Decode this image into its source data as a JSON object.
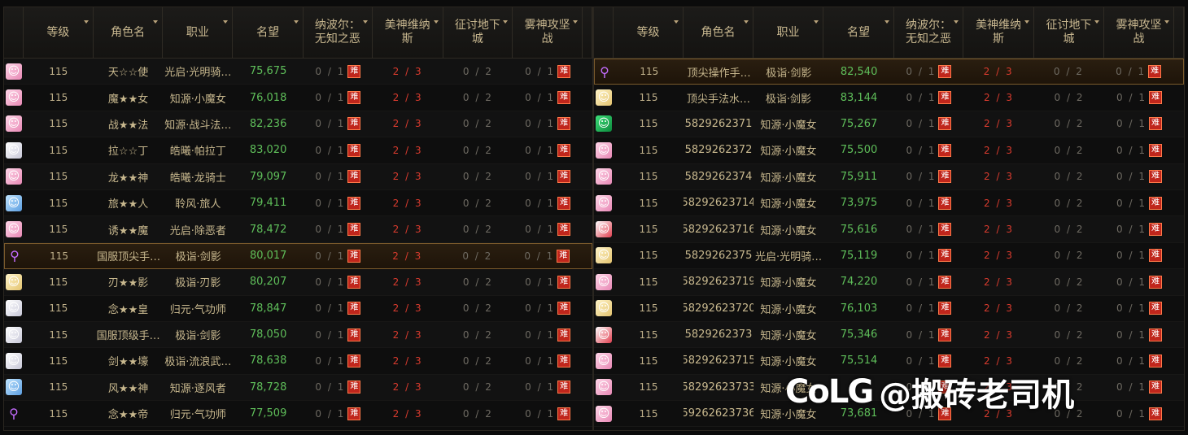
{
  "columns": {
    "level": "等级",
    "name": "角色名",
    "job": "职业",
    "reputation": "名望",
    "nabel": "纳波尔：\n无知之恶",
    "venus": "美神维纳\n斯",
    "dungeon": "征讨地下\n城",
    "fog": "雾神攻坚\n战"
  },
  "hard_badge": "难",
  "left_rows": [
    {
      "icon": "avatar-pink-icon",
      "tone": "pink",
      "level": "115",
      "name": "天☆☆使",
      "job": "光启·光明骑…",
      "rep": "75,675",
      "nabel": "0 / 1",
      "venus": "2 / 3",
      "dungeon": "0 / 2",
      "fog": "0 / 1"
    },
    {
      "icon": "avatar-pink-icon",
      "tone": "pink",
      "level": "115",
      "name": "魔★★女",
      "job": "知源·小魔女",
      "rep": "76,018",
      "nabel": "0 / 1",
      "venus": "2 / 3",
      "dungeon": "0 / 2",
      "fog": "0 / 1"
    },
    {
      "icon": "avatar-pink-icon",
      "tone": "pink",
      "level": "115",
      "name": "战★★法",
      "job": "知源·战斗法…",
      "rep": "82,236",
      "nabel": "0 / 1",
      "venus": "2 / 3",
      "dungeon": "0 / 2",
      "fog": "0 / 1"
    },
    {
      "icon": "avatar-white-icon",
      "tone": "white",
      "level": "115",
      "name": "拉☆☆丁",
      "job": "皓曦·帕拉丁",
      "rep": "83,020",
      "nabel": "0 / 1",
      "venus": "2 / 3",
      "dungeon": "0 / 2",
      "fog": "0 / 1"
    },
    {
      "icon": "avatar-pink-icon",
      "tone": "pink",
      "level": "115",
      "name": "龙★★神",
      "job": "皓曦·龙骑士",
      "rep": "79,097",
      "nabel": "0 / 1",
      "venus": "2 / 3",
      "dungeon": "0 / 2",
      "fog": "0 / 1"
    },
    {
      "icon": "avatar-blue-icon",
      "tone": "blue",
      "level": "115",
      "name": "旅★★人",
      "job": "聆风·旅人",
      "rep": "79,411",
      "nabel": "0 / 1",
      "venus": "2 / 3",
      "dungeon": "0 / 2",
      "fog": "0 / 1"
    },
    {
      "icon": "avatar-pink-icon",
      "tone": "pink",
      "level": "115",
      "name": "诱★★魔",
      "job": "光启·除恶者",
      "rep": "78,472",
      "nabel": "0 / 1",
      "venus": "2 / 3",
      "dungeon": "0 / 2",
      "fog": "0 / 1"
    },
    {
      "icon": "sword-icon",
      "tone": "purple",
      "level": "115",
      "name": "国服顶尖手…",
      "job": "极诣·剑影",
      "rep": "80,017",
      "nabel": "0 / 1",
      "venus": "2 / 3",
      "dungeon": "0 / 2",
      "fog": "0 / 1",
      "highlight": true
    },
    {
      "icon": "avatar-blond-icon",
      "tone": "blond",
      "level": "115",
      "name": "刃★★影",
      "job": "极诣·刃影",
      "rep": "80,207",
      "nabel": "0 / 1",
      "venus": "2 / 3",
      "dungeon": "0 / 2",
      "fog": "0 / 1"
    },
    {
      "icon": "avatar-white-icon",
      "tone": "white",
      "level": "115",
      "name": "念★★皇",
      "job": "归元·气功师",
      "rep": "78,847",
      "nabel": "0 / 1",
      "venus": "2 / 3",
      "dungeon": "0 / 2",
      "fog": "0 / 1"
    },
    {
      "icon": "avatar-white-icon",
      "tone": "white",
      "level": "115",
      "name": "国服顶级手…",
      "job": "极诣·剑影",
      "rep": "78,050",
      "nabel": "0 / 1",
      "venus": "2 / 3",
      "dungeon": "0 / 2",
      "fog": "0 / 1"
    },
    {
      "icon": "avatar-white-icon",
      "tone": "white",
      "level": "115",
      "name": "剑★★壕",
      "job": "极诣·流浪武…",
      "rep": "78,638",
      "nabel": "0 / 1",
      "venus": "2 / 3",
      "dungeon": "0 / 2",
      "fog": "0 / 1"
    },
    {
      "icon": "avatar-blue-icon",
      "tone": "blue",
      "level": "115",
      "name": "风★★神",
      "job": "知源·逐风者",
      "rep": "78,728",
      "nabel": "0 / 1",
      "venus": "2 / 3",
      "dungeon": "0 / 2",
      "fog": "0 / 1"
    },
    {
      "icon": "staff-icon",
      "tone": "purple",
      "level": "115",
      "name": "念★★帝",
      "job": "归元·气功师",
      "rep": "77,509",
      "nabel": "0 / 1",
      "venus": "2 / 3",
      "dungeon": "0 / 2",
      "fog": "0 / 1"
    }
  ],
  "right_rows": [
    {
      "icon": "staff-icon",
      "tone": "purple",
      "level": "115",
      "name": "顶尖操作手…",
      "job": "极诣·剑影",
      "rep": "82,540",
      "nabel": "0 / 1",
      "venus": "2 / 3",
      "dungeon": "0 / 2",
      "fog": "0 / 1",
      "highlight": true
    },
    {
      "icon": "avatar-blond-icon",
      "tone": "blond",
      "level": "115",
      "name": "顶尖手法水…",
      "job": "极诣·剑影",
      "rep": "83,144",
      "nabel": "0 / 1",
      "venus": "2 / 3",
      "dungeon": "0 / 2",
      "fog": "0 / 1"
    },
    {
      "icon": "avatar-green-icon",
      "tone": "green",
      "level": "115",
      "name": "5829262371",
      "job": "知源·小魔女",
      "rep": "75,267",
      "nabel": "0 / 1",
      "venus": "2 / 3",
      "dungeon": "0 / 2",
      "fog": "0 / 1"
    },
    {
      "icon": "avatar-pink-icon",
      "tone": "pink",
      "level": "115",
      "name": "5829262372",
      "job": "知源·小魔女",
      "rep": "75,500",
      "nabel": "0 / 1",
      "venus": "2 / 3",
      "dungeon": "0 / 2",
      "fog": "0 / 1"
    },
    {
      "icon": "avatar-pink-icon",
      "tone": "pink",
      "level": "115",
      "name": "5829262374",
      "job": "知源·小魔女",
      "rep": "75,911",
      "nabel": "0 / 1",
      "venus": "2 / 3",
      "dungeon": "0 / 2",
      "fog": "0 / 1"
    },
    {
      "icon": "avatar-pink-icon",
      "tone": "pink",
      "level": "115",
      "name": "58292623714",
      "job": "知源·小魔女",
      "rep": "73,975",
      "nabel": "0 / 1",
      "venus": "2 / 3",
      "dungeon": "0 / 2",
      "fog": "0 / 1"
    },
    {
      "icon": "avatar-red-icon",
      "tone": "red",
      "level": "115",
      "name": "58292623716",
      "job": "知源·小魔女",
      "rep": "75,616",
      "nabel": "0 / 1",
      "venus": "2 / 3",
      "dungeon": "0 / 2",
      "fog": "0 / 1"
    },
    {
      "icon": "avatar-blond-icon",
      "tone": "blond",
      "level": "115",
      "name": "5829262375",
      "job": "光启·光明骑…",
      "rep": "75,119",
      "nabel": "0 / 1",
      "venus": "2 / 3",
      "dungeon": "0 / 2",
      "fog": "0 / 1"
    },
    {
      "icon": "avatar-pink-icon",
      "tone": "pink",
      "level": "115",
      "name": "58292623719",
      "job": "知源·小魔女",
      "rep": "74,220",
      "nabel": "0 / 1",
      "venus": "2 / 3",
      "dungeon": "0 / 2",
      "fog": "0 / 1"
    },
    {
      "icon": "avatar-blond-icon",
      "tone": "blond",
      "level": "115",
      "name": "58292623720",
      "job": "知源·小魔女",
      "rep": "76,103",
      "nabel": "0 / 1",
      "venus": "2 / 3",
      "dungeon": "0 / 2",
      "fog": "0 / 1"
    },
    {
      "icon": "avatar-red-icon",
      "tone": "red",
      "level": "115",
      "name": "5829262373",
      "job": "知源·小魔女",
      "rep": "75,346",
      "nabel": "0 / 1",
      "venus": "2 / 3",
      "dungeon": "0 / 2",
      "fog": "0 / 1"
    },
    {
      "icon": "avatar-pink-icon",
      "tone": "pink",
      "level": "115",
      "name": "58292623715",
      "job": "知源·小魔女",
      "rep": "75,514",
      "nabel": "0 / 1",
      "venus": "2 / 3",
      "dungeon": "0 / 2",
      "fog": "0 / 1"
    },
    {
      "icon": "avatar-pink-icon",
      "tone": "pink",
      "level": "115",
      "name": "58292623733",
      "job": "知源·小魔女",
      "rep": "",
      "nabel": "0 / 1",
      "venus": "2 / 3",
      "dungeon": "0 / 2",
      "fog": "0 / 1"
    },
    {
      "icon": "avatar-pink-icon",
      "tone": "pink",
      "level": "115",
      "name": "59262623736",
      "job": "知源·小魔女",
      "rep": "73,681",
      "nabel": "0 / 1",
      "venus": "2 / 3",
      "dungeon": "0 / 2",
      "fog": "0 / 1"
    }
  ],
  "watermark": {
    "logo": "CoLG",
    "handle": "@搬砖老司机"
  }
}
